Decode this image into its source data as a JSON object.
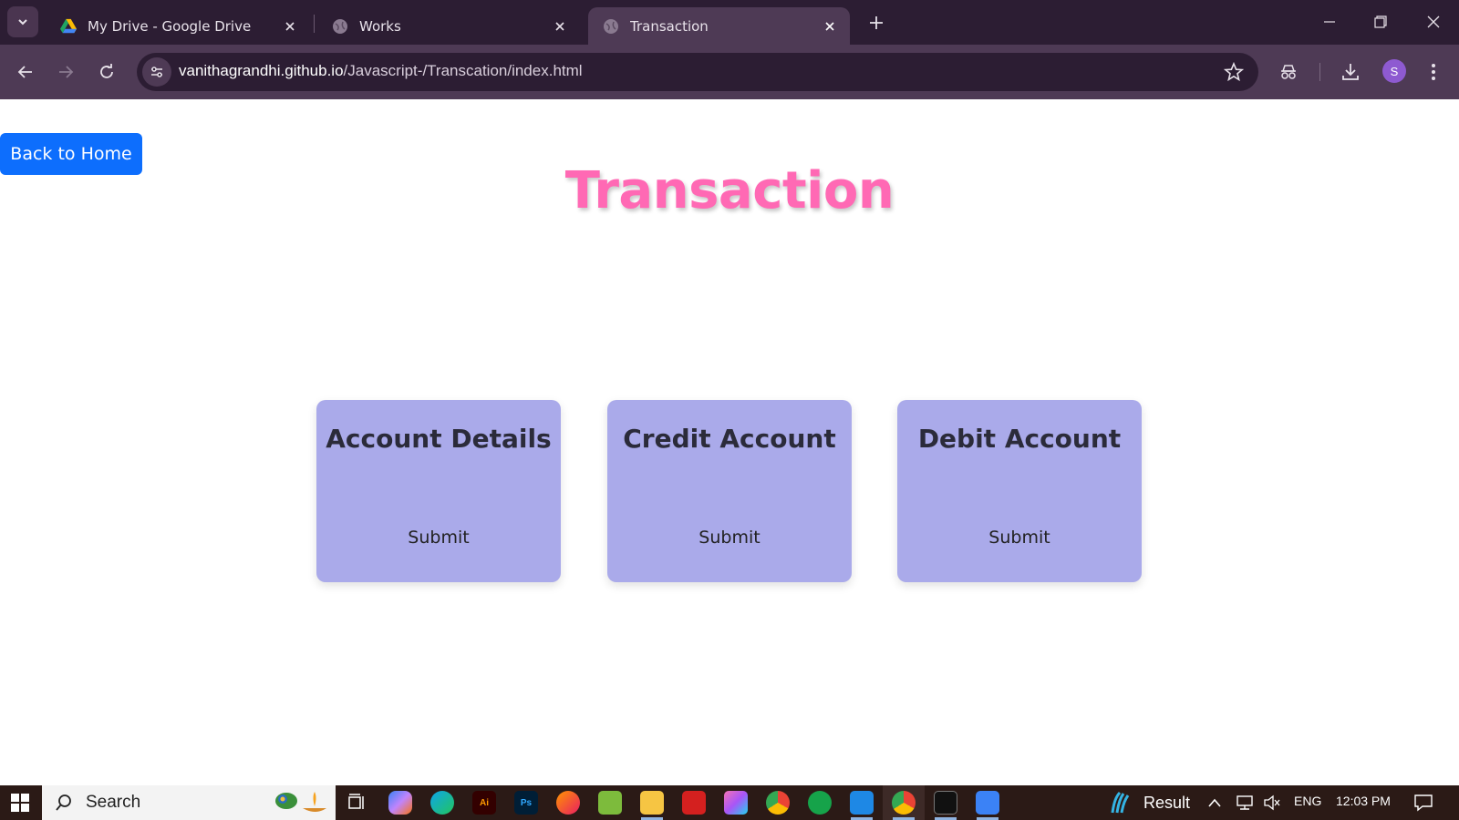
{
  "browser": {
    "tabs": [
      {
        "title": "My Drive - Google Drive",
        "favicon": "google-drive-icon",
        "active": false
      },
      {
        "title": "Works",
        "favicon": "globe-icon",
        "active": false
      },
      {
        "title": "Transaction",
        "favicon": "globe-icon",
        "active": true
      }
    ],
    "url_host": "vanithagrandhi.github.io",
    "url_path": "/Javascript-/Transcation/index.html",
    "profile_initial": "S"
  },
  "page": {
    "back_button_label": "Back to Home",
    "heading": "Transaction",
    "cards": [
      {
        "title": "Account Details",
        "button_label": "Submit"
      },
      {
        "title": "Credit Account",
        "button_label": "Submit"
      },
      {
        "title": "Debit Account",
        "button_label": "Submit"
      }
    ],
    "colors": {
      "heading": "#ff69b4",
      "card_background": "#aaaaea",
      "back_button": "#0d6efd",
      "browser_frame": "#2c1d33",
      "browser_toolbar": "#4e3a55"
    }
  },
  "taskbar": {
    "search_label": "Search",
    "widget_label": "Result",
    "language": "ENG",
    "time": "12:03 PM",
    "apps": [
      "task-view-icon",
      "copilot-icon",
      "edge-icon",
      "illustrator-icon",
      "photoshop-icon",
      "firefox-icon",
      "notepad-icon",
      "file-explorer-icon",
      "acrobat-icon",
      "photo-app-icon",
      "chrome-icon",
      "xbox-icon",
      "vscode-icon",
      "chrome-profile-icon",
      "terminal-icon",
      "paint-icon"
    ]
  }
}
